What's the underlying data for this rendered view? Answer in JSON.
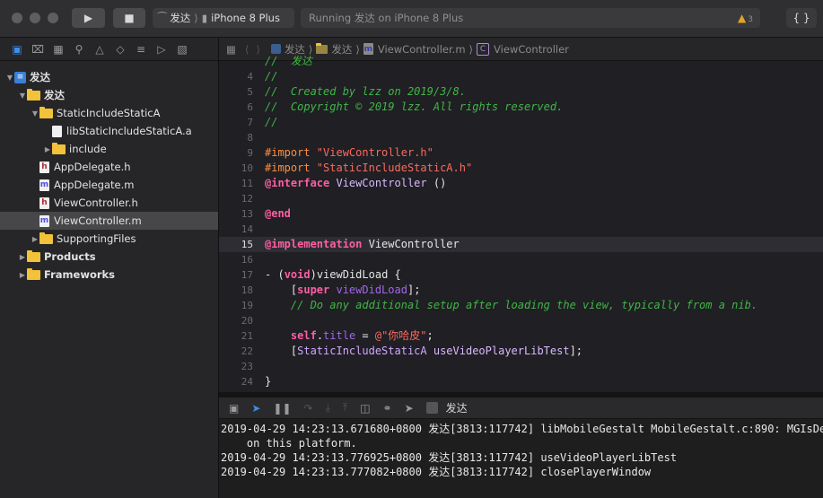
{
  "toolbar": {
    "scheme_target": "发达",
    "scheme_device": "iPhone 8 Plus",
    "status_text": "Running 发达 on iPhone 8 Plus",
    "warning_count": "3",
    "library_label": "{ }"
  },
  "navigator": {
    "tree": [
      {
        "label": "发达",
        "kind": "project",
        "depth": 0,
        "disclosure": "open",
        "selected": false
      },
      {
        "label": "发达",
        "kind": "folder",
        "depth": 1,
        "disclosure": "open",
        "selected": false
      },
      {
        "label": "StaticIncludeStaticA",
        "kind": "folder",
        "depth": 2,
        "disclosure": "open",
        "selected": false
      },
      {
        "label": "libStaticIncludeStaticA.a",
        "kind": "lib",
        "depth": 3,
        "disclosure": "none",
        "selected": false
      },
      {
        "label": "include",
        "kind": "folder",
        "depth": 3,
        "disclosure": "closed",
        "selected": false
      },
      {
        "label": "AppDelegate.h",
        "kind": "h",
        "depth": 2,
        "disclosure": "none",
        "selected": false
      },
      {
        "label": "AppDelegate.m",
        "kind": "m",
        "depth": 2,
        "disclosure": "none",
        "selected": false
      },
      {
        "label": "ViewController.h",
        "kind": "h",
        "depth": 2,
        "disclosure": "none",
        "selected": false
      },
      {
        "label": "ViewController.m",
        "kind": "m",
        "depth": 2,
        "disclosure": "none",
        "selected": true
      },
      {
        "label": "SupportingFiles",
        "kind": "folder",
        "depth": 2,
        "disclosure": "closed",
        "selected": false
      },
      {
        "label": "Products",
        "kind": "folder",
        "depth": 1,
        "disclosure": "closed",
        "selected": false
      },
      {
        "label": "Frameworks",
        "kind": "folder",
        "depth": 1,
        "disclosure": "closed",
        "selected": false
      }
    ]
  },
  "jumpbar": {
    "crumbs": [
      "发达",
      "发达",
      "ViewController.m",
      "ViewController"
    ]
  },
  "editor": {
    "current_line": "15",
    "lines": [
      {
        "n": "",
        "tokens": [
          [
            "c-comment",
            "//  发达"
          ]
        ]
      },
      {
        "n": "4",
        "tokens": [
          [
            "c-comment",
            "//"
          ]
        ]
      },
      {
        "n": "5",
        "tokens": [
          [
            "c-comment",
            "//  Created by lzz on 2019/3/8."
          ]
        ]
      },
      {
        "n": "6",
        "tokens": [
          [
            "c-comment",
            "//  Copyright © 2019 lzz. All rights reserved."
          ]
        ]
      },
      {
        "n": "7",
        "tokens": [
          [
            "c-comment",
            "//"
          ]
        ]
      },
      {
        "n": "8",
        "tokens": []
      },
      {
        "n": "9",
        "tokens": [
          [
            "c-dir",
            "#import "
          ],
          [
            "c-str",
            "\"ViewController.h\""
          ]
        ]
      },
      {
        "n": "10",
        "tokens": [
          [
            "c-dir",
            "#import "
          ],
          [
            "c-str",
            "\"StaticIncludeStaticA.h\""
          ]
        ]
      },
      {
        "n": "11",
        "tokens": [
          [
            "c-kw",
            "@interface"
          ],
          [
            "c-plain",
            " "
          ],
          [
            "c-proj",
            "ViewController"
          ],
          [
            "c-plain",
            " ()"
          ]
        ]
      },
      {
        "n": "12",
        "tokens": []
      },
      {
        "n": "13",
        "tokens": [
          [
            "c-kw",
            "@end"
          ]
        ]
      },
      {
        "n": "14",
        "tokens": []
      },
      {
        "n": "15",
        "tokens": [
          [
            "c-kw",
            "@implementation"
          ],
          [
            "c-plain",
            " ViewController"
          ]
        ]
      },
      {
        "n": "16",
        "tokens": []
      },
      {
        "n": "17",
        "tokens": [
          [
            "c-plain",
            "- ("
          ],
          [
            "c-kw",
            "void"
          ],
          [
            "c-plain",
            ")viewDidLoad {"
          ]
        ]
      },
      {
        "n": "18",
        "tokens": [
          [
            "c-plain",
            "    ["
          ],
          [
            "c-kw",
            "super"
          ],
          [
            "c-plain",
            " "
          ],
          [
            "c-func",
            "viewDidLoad"
          ],
          [
            "c-plain",
            "];"
          ]
        ]
      },
      {
        "n": "19",
        "tokens": [
          [
            "c-plain",
            "    "
          ],
          [
            "c-comment",
            "// Do any additional setup after loading the view, typically from a nib."
          ]
        ]
      },
      {
        "n": "20",
        "tokens": []
      },
      {
        "n": "21",
        "tokens": [
          [
            "c-plain",
            "    "
          ],
          [
            "c-kw",
            "self"
          ],
          [
            "c-plain",
            "."
          ],
          [
            "c-func",
            "title"
          ],
          [
            "c-plain",
            " = "
          ],
          [
            "c-str",
            "@\"你哈皮\""
          ],
          [
            "c-plain",
            ";"
          ]
        ]
      },
      {
        "n": "22",
        "tokens": [
          [
            "c-plain",
            "    ["
          ],
          [
            "c-cls",
            "StaticIncludeStaticA"
          ],
          [
            "c-plain",
            " "
          ],
          [
            "c-proj",
            "useVideoPlayerLibTest"
          ],
          [
            "c-plain",
            "];"
          ]
        ]
      },
      {
        "n": "23",
        "tokens": []
      },
      {
        "n": "24",
        "tokens": [
          [
            "c-plain",
            "}"
          ]
        ]
      }
    ]
  },
  "debugbar": {
    "process": "发达"
  },
  "console": {
    "lines": [
      "2019-04-29 14:23:13.671680+0800 发达[3813:117742] libMobileGestalt MobileGestalt.c:890: MGIsDeviceOneOfType is not supported",
      "    on this platform.",
      "2019-04-29 14:23:13.776925+0800 发达[3813:117742] useVideoPlayerLibTest",
      "2019-04-29 14:23:13.777082+0800 发达[3813:117742] closePlayerWindow"
    ]
  },
  "colors": {
    "selection": "#474749",
    "accent": "#3d8fe8",
    "warning": "#e0a32a",
    "folder": "#f1c23a"
  }
}
